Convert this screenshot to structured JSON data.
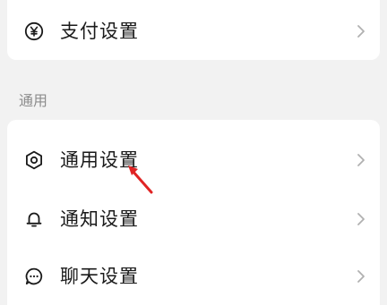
{
  "payment_section": {
    "items": [
      {
        "label": "支付设置",
        "icon": "yen-circle-icon"
      }
    ]
  },
  "general_section": {
    "title": "通用",
    "items": [
      {
        "label": "通用设置",
        "icon": "gear-icon"
      },
      {
        "label": "通知设置",
        "icon": "bell-icon"
      },
      {
        "label": "聊天设置",
        "icon": "chat-bubble-icon"
      }
    ]
  },
  "colors": {
    "background": "#f2f2f2",
    "card": "#ffffff",
    "text": "#1a1a1a",
    "section_label": "#8c8c8c",
    "chevron": "#b0b0b0",
    "annotation_arrow": "#e02424"
  }
}
